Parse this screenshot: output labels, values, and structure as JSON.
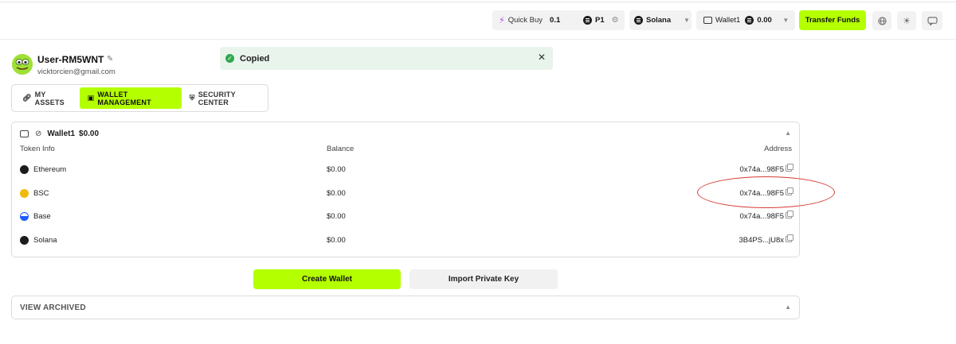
{
  "header": {
    "quick_buy": {
      "label": "Quick Buy",
      "amount": "0.1",
      "preset": "P1"
    },
    "network": {
      "label": "Solana"
    },
    "wallet_selector": {
      "label": "Wallet1",
      "amount": "0.00"
    },
    "transfer_label": "Transfer Funds"
  },
  "toast": {
    "message": "Copied",
    "close": "✕"
  },
  "profile": {
    "username": "User-RM5WNT",
    "email": "vicktorcien@gmail.com"
  },
  "tabs": [
    {
      "label": "MY ASSETS",
      "icon": "link-icon",
      "active": false
    },
    {
      "label": "WALLET MANAGEMENT",
      "icon": "wallet-icon",
      "active": true
    },
    {
      "label": "SECURITY CENTER",
      "icon": "shield-icon",
      "active": false
    }
  ],
  "wallet_panel": {
    "name": "Wallet1",
    "balance": "$0.00",
    "columns": {
      "token": "Token Info",
      "balance": "Balance",
      "address": "Address"
    },
    "rows": [
      {
        "token": "Ethereum",
        "balance": "$0.00",
        "address": "0x74a...98F5",
        "icon": "ethereum-icon",
        "color": "#1c1c1c"
      },
      {
        "token": "BSC",
        "balance": "$0.00",
        "address": "0x74a...98F5",
        "icon": "bsc-icon",
        "color": "#f0b90b"
      },
      {
        "token": "Base",
        "balance": "$0.00",
        "address": "0x74a...98F5",
        "icon": "base-icon",
        "color": "#1b5bff"
      },
      {
        "token": "Solana",
        "balance": "$0.00",
        "address": "3B4PS...jU8x",
        "icon": "solana-icon",
        "color": "#1c1c1c"
      }
    ]
  },
  "actions": {
    "create_wallet": "Create Wallet",
    "import_key": "Import Private Key"
  },
  "archived": {
    "label": "VIEW ARCHIVED"
  },
  "colors": {
    "accent": "#b4ff00",
    "annotation": "#d63a32",
    "toast_bg": "#e9f4ec",
    "success": "#2fa84f"
  }
}
